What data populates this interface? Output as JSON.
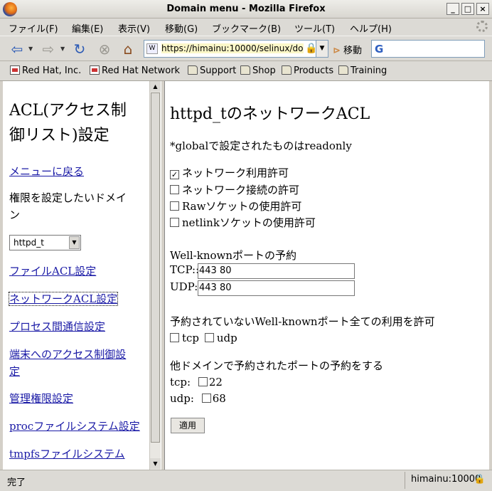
{
  "window": {
    "title": "Domain menu - Mozilla Firefox",
    "controls": {
      "minimize": "_",
      "maximize": "□",
      "close": "×"
    }
  },
  "menu": [
    "ファイル(F)",
    "編集(E)",
    "表示(V)",
    "移動(G)",
    "ブックマーク(B)",
    "ツール(T)",
    "ヘルプ(H)"
  ],
  "toolbar": {
    "url": "https://himainu:10000/selinux/domain",
    "go_label": "移動",
    "search_value": ""
  },
  "bookmarks": [
    {
      "label": "Red Hat, Inc.",
      "icon": "page-icon"
    },
    {
      "label": "Red Hat Network",
      "icon": "page-icon"
    },
    {
      "label": "Support",
      "icon": "folder-icon"
    },
    {
      "label": "Shop",
      "icon": "folder-icon"
    },
    {
      "label": "Products",
      "icon": "folder-icon"
    },
    {
      "label": "Training",
      "icon": "folder-icon"
    }
  ],
  "sidebar": {
    "heading_line1": "ACL(アクセス制",
    "heading_line2": "御リスト)設定",
    "back_link": "メニューに戻る",
    "domain_prompt_line1": "権限を設定したいドメイ",
    "domain_prompt_line2": "ン",
    "domain_selected": "httpd_t",
    "links": [
      "ファイルACL設定",
      "ネットワークACL設定",
      "プロセス間通信設定",
      "端末へのアクセス制御設",
      "定",
      "管理権限設定",
      "procファイルシステム設定",
      "tmpfsファイルシステム"
    ]
  },
  "main": {
    "title": "httpd_tのネットワークACL",
    "note": "*globalで設定されたものはreadonly",
    "permissions": [
      {
        "label": "ネットワーク利用許可",
        "checked": true
      },
      {
        "label": "ネットワーク接続の許可",
        "checked": false
      },
      {
        "label": "Rawソケットの使用許可",
        "checked": false
      },
      {
        "label": "netlinkソケットの使用許可",
        "checked": false
      }
    ],
    "wellknown_heading": "Well-knownポートの予約",
    "tcp_label": "TCP::",
    "tcp_value": "443 80",
    "udp_label": "UDP::",
    "udp_value": "443 80",
    "unreserved_heading": "予約されていないWell-knownポート全ての利用を許可",
    "unreserved_tcp": "tcp",
    "unreserved_udp": "udp",
    "other_heading": "他ドメインで予約されたポートの予約をする",
    "other_tcp_label": "tcp:",
    "other_tcp_port": "22",
    "other_udp_label": "udp:",
    "other_udp_port": "68",
    "apply_label": "適用"
  },
  "status": {
    "text": "完了",
    "host": "himainu:10000"
  }
}
